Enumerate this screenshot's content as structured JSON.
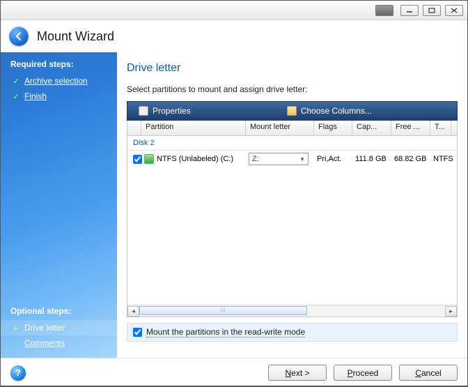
{
  "header": {
    "title": "Mount Wizard"
  },
  "sidebar": {
    "required_heading": "Required steps:",
    "required": [
      {
        "label": "Archive selection"
      },
      {
        "label": "Finish"
      }
    ],
    "optional_heading": "Optional steps:",
    "optional": [
      {
        "label": "Drive letter"
      },
      {
        "label": "Comments"
      }
    ]
  },
  "main": {
    "title": "Drive letter",
    "instruction": "Select partitions to mount and assign drive letter:",
    "toolbar": {
      "properties": "Properties",
      "choose_columns": "Choose Columns..."
    },
    "columns": [
      "Partition",
      "Mount letter",
      "Flags",
      "Cap...",
      "Free ...",
      "T..."
    ],
    "disks": [
      {
        "label": "Disk 2",
        "partitions": [
          {
            "checked": true,
            "name": "NTFS (Unlabeled) (C:)",
            "mount_letter": "Z:",
            "flags": "Pri,Act.",
            "capacity": "111.8 GB",
            "free": "68.82 GB",
            "type": "NTFS"
          }
        ]
      }
    ],
    "read_write_checked": true,
    "read_write_label": "Mount the partitions in the read-write mode"
  },
  "footer": {
    "next_u": "N",
    "next_rest": "ext >",
    "proceed_u": "P",
    "proceed_rest": "roceed",
    "cancel_u": "C",
    "cancel_rest": "ancel"
  }
}
